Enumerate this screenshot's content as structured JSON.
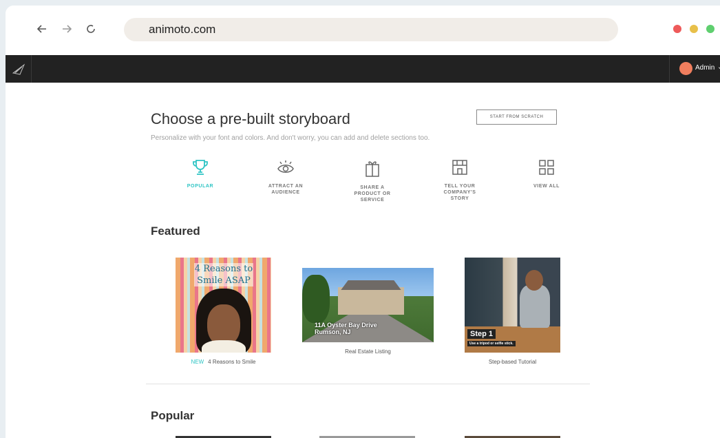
{
  "browser": {
    "url": "animoto.com",
    "back_icon": "arrow-left-icon",
    "forward_icon": "arrow-right-icon",
    "reload_icon": "reload-icon",
    "window_dots": [
      "#ee5a5a",
      "#e8c04a",
      "#5fcf6f"
    ]
  },
  "app_header": {
    "logo_icon": "animoto-logo-icon",
    "user_label": "Admin"
  },
  "page": {
    "title": "Choose a pre-built storyboard",
    "subtitle": "Personalize with your font and colors. And don't worry, you can add and delete sections too.",
    "start_button": "START FROM SCRATCH"
  },
  "categories": [
    {
      "label": "POPULAR",
      "icon": "trophy-icon",
      "active": true
    },
    {
      "label": "ATTRACT AN\nAUDIENCE",
      "icon": "eye-icon",
      "active": false
    },
    {
      "label": "SHARE A\nPRODUCT OR\nSERVICE",
      "icon": "gift-icon",
      "active": false
    },
    {
      "label": "TELL YOUR\nCOMPANY'S\nSTORY",
      "icon": "storefront-icon",
      "active": false
    },
    {
      "label": "VIEW ALL",
      "icon": "grid-icon",
      "active": false
    }
  ],
  "featured": {
    "heading": "Featured",
    "cards": [
      {
        "badge": "NEW",
        "caption": "4 Reasons to Smile",
        "overlay_line1": "4 Reasons to",
        "overlay_line2": "Smile ASAP"
      },
      {
        "caption": "Real Estate Listing",
        "overlay_line1": "11A Oyster Bay Drive",
        "overlay_line2": "Rumson, NJ"
      },
      {
        "caption": "Step-based Tutorial",
        "overlay_line1": "Step 1",
        "overlay_line2": "Use a tripod or selfie stick."
      }
    ]
  },
  "popular": {
    "heading": "Popular"
  },
  "colors": {
    "accent": "#2ec4c4",
    "header_bg": "#222222",
    "avatar": "#f07e5e"
  }
}
